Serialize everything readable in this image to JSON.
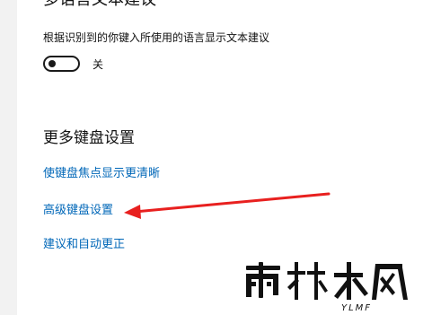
{
  "settings": {
    "partial_heading": "多语言文本建议",
    "description": "根据识别到的你键入所使用的语言显示文本建议",
    "toggle": {
      "state_label": "关",
      "on": false
    },
    "more_heading": "更多键盘设置",
    "links": [
      "使键盘焦点显示更清晰",
      "高级键盘设置",
      "建议和自动更正"
    ]
  },
  "annotation": {
    "arrow_color": "#e8201f"
  },
  "watermark": {
    "logo_text": "雨林木风",
    "sub_text": "YLMF"
  },
  "colors": {
    "link": "#0067b8",
    "text": "#111111",
    "background": "#ffffff"
  }
}
